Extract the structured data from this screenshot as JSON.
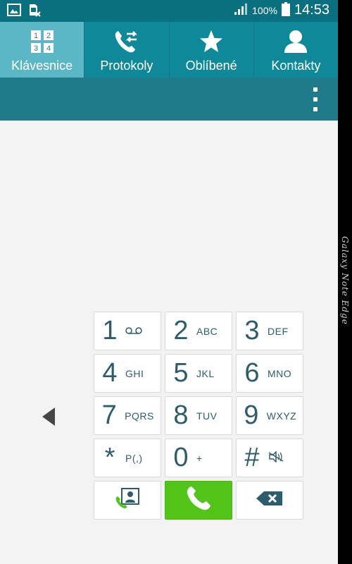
{
  "status_bar": {
    "battery": "100%",
    "time": "14:53",
    "icons": [
      "gallery-icon",
      "sim-off-icon",
      "signal-icon",
      "battery-icon"
    ]
  },
  "tabs": [
    {
      "label": "Klávesnice",
      "icon": "dialpad-grid-icon",
      "active": true,
      "glyphs": [
        "1",
        "2",
        "3",
        "4"
      ]
    },
    {
      "label": "Protokoly",
      "icon": "call-log-icon",
      "active": false
    },
    {
      "label": "Oblíbené",
      "icon": "star-icon",
      "active": false
    },
    {
      "label": "Kontakty",
      "icon": "person-icon",
      "active": false
    }
  ],
  "action_bar": {
    "menu_icon": "overflow-menu-icon"
  },
  "dialpad": {
    "keys": [
      {
        "digit": "1",
        "letters": "",
        "sub_icon": "voicemail-icon"
      },
      {
        "digit": "2",
        "letters": "ABC"
      },
      {
        "digit": "3",
        "letters": "DEF"
      },
      {
        "digit": "4",
        "letters": "GHI"
      },
      {
        "digit": "5",
        "letters": "JKL"
      },
      {
        "digit": "6",
        "letters": "MNO"
      },
      {
        "digit": "7",
        "letters": "PQRS"
      },
      {
        "digit": "8",
        "letters": "TUV"
      },
      {
        "digit": "9",
        "letters": "WXYZ"
      },
      {
        "digit": "*",
        "letters": "P(,)"
      },
      {
        "digit": "0",
        "letters": "+"
      },
      {
        "digit": "#",
        "letters": "",
        "sub_icon": "mute-icon"
      }
    ],
    "bottom_row": [
      {
        "icon": "add-contact-icon"
      },
      {
        "icon": "phone-call-icon"
      },
      {
        "icon": "backspace-icon"
      }
    ]
  },
  "edge_label": "Galaxy Note Edge",
  "colors": {
    "status_bar": "#0a6f7f",
    "tab_bar": "#0f8899",
    "tab_active": "#5bb6c6",
    "action_bar": "#1f7b8a",
    "key_text": "#2f5c6b",
    "call_green": "#52c41a",
    "background": "#f3f3f3"
  }
}
